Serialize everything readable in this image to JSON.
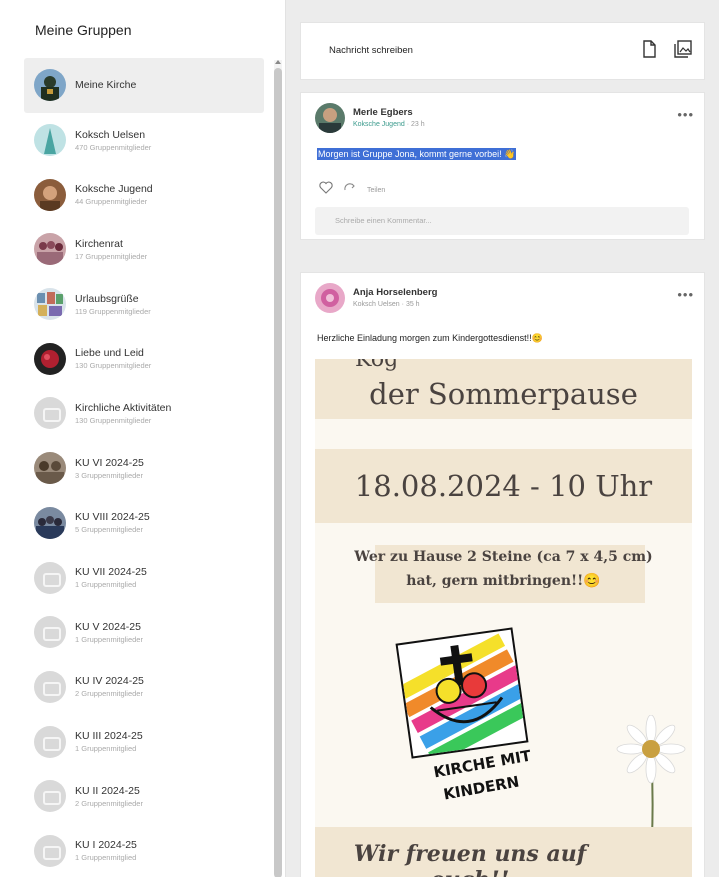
{
  "sidebar": {
    "title": "Meine Gruppen",
    "groups": [
      {
        "name": "Meine Kirche",
        "sub": ""
      },
      {
        "name": "Koksch Uelsen",
        "sub": "470 Gruppenmitglieder"
      },
      {
        "name": "Koksche Jugend",
        "sub": "44 Gruppenmitglieder"
      },
      {
        "name": "Kirchenrat",
        "sub": "17 Gruppenmitglieder"
      },
      {
        "name": "Urlaubsgrüße",
        "sub": "119 Gruppenmitglieder"
      },
      {
        "name": "Liebe und Leid",
        "sub": "130 Gruppenmitglieder"
      },
      {
        "name": "Kirchliche Aktivitäten",
        "sub": "130 Gruppenmitglieder"
      },
      {
        "name": "KU VI 2024-25",
        "sub": "3 Gruppenmitglieder"
      },
      {
        "name": "KU VIII 2024-25",
        "sub": "5 Gruppenmitglieder"
      },
      {
        "name": "KU VII 2024-25",
        "sub": "1 Gruppenmitglied"
      },
      {
        "name": "KU V 2024-25",
        "sub": "1 Gruppenmitglieder"
      },
      {
        "name": "KU IV 2024-25",
        "sub": "2 Gruppenmitglieder"
      },
      {
        "name": "KU III 2024-25",
        "sub": "1 Gruppenmitglied"
      },
      {
        "name": "KU II 2024-25",
        "sub": "2 Gruppenmitglieder"
      },
      {
        "name": "KU I 2024-25",
        "sub": "1 Gruppenmitglied"
      }
    ]
  },
  "compose": {
    "label": "Nachricht schreiben",
    "icons": [
      "document-icon",
      "image-gallery-icon"
    ]
  },
  "post1": {
    "author": "Merle Egbers",
    "group": "Koksche Jugend",
    "time": "23 h",
    "text": "Morgen ist Gruppe Jona, kommt gerne vorbei! 👋",
    "share_label": "Teilen",
    "reaction_placeholder": "Schreibe einen Kommentar..."
  },
  "post2": {
    "author": "Anja Horselenberg",
    "group": "Koksch Uelsen",
    "time": "35 h",
    "text": "Herzliche Einladung morgen zum Kindergottesdienst!!😊",
    "poster": {
      "line_top": "Kog",
      "line1": "der Sommerpause",
      "date": "18.08.2024 - 10 Uhr",
      "note1": "Wer zu Hause 2 Steine (ca 7 x 4,5 cm)",
      "note2": "hat, gern mitbringen!!😊",
      "logo1": "KIRCHE MIT",
      "logo2": "KINDERN",
      "footer": "Wir freuen uns auf euch!!"
    }
  }
}
